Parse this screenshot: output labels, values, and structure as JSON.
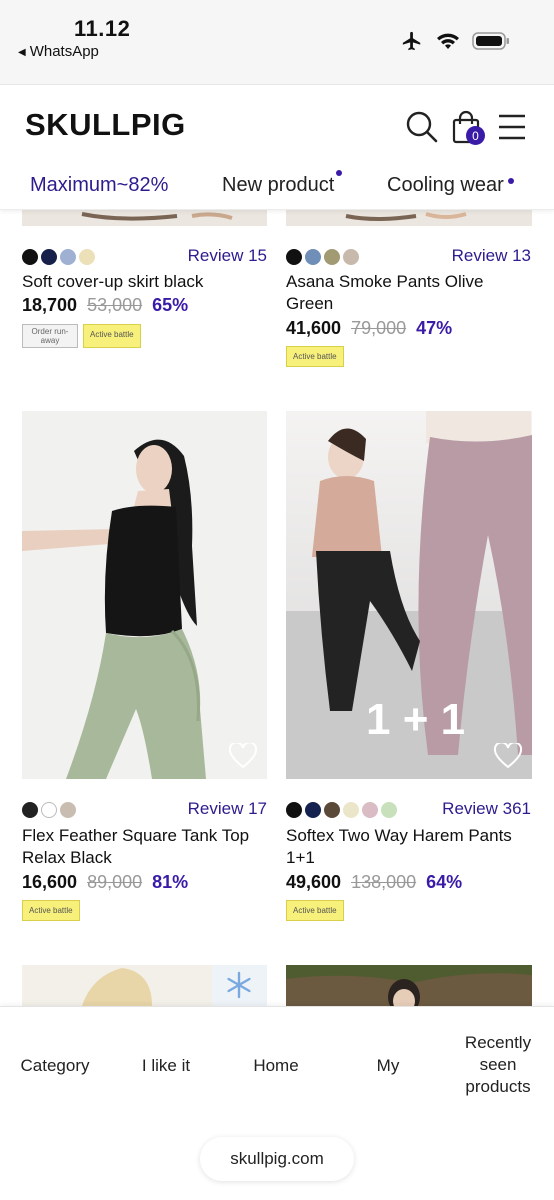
{
  "status_bar": {
    "time": "11.12",
    "back_app": "WhatsApp"
  },
  "header": {
    "logo": "SKULLPIG",
    "cart_count": "0"
  },
  "tabs": [
    {
      "label": "Maximum~82%",
      "active": true
    },
    {
      "label": "New product",
      "active": false
    },
    {
      "label": "Cooling wear",
      "active": false
    }
  ],
  "products": [
    {
      "name": "Soft cover-up skirt black",
      "price": "18,700",
      "old_price": "53,000",
      "discount": "65%",
      "review": "Review 15",
      "swatches": [
        "#111111",
        "#16204a",
        "#9fb0d3",
        "#ece0b8"
      ],
      "tags": [
        {
          "label": "Order run-away",
          "style": "gray"
        },
        {
          "label": "Active battle",
          "style": "yellow"
        }
      ]
    },
    {
      "name": "Asana Smoke Pants Olive Green",
      "price": "41,600",
      "old_price": "79,000",
      "discount": "47%",
      "review": "Review 13",
      "swatches": [
        "#111111",
        "#6f8fb8",
        "#a19a72",
        "#c7b9ab"
      ],
      "tags": [
        {
          "label": "Active battle",
          "style": "yellow"
        }
      ]
    },
    {
      "name": "Flex Feather Square Tank Top Relax Black",
      "price": "16,600",
      "old_price": "89,000",
      "discount": "81%",
      "review": "Review 17",
      "swatches": [
        "#222222",
        "#ffffff",
        "#c9bcb0"
      ],
      "tags": [
        {
          "label": "Active battle",
          "style": "yellow"
        }
      ]
    },
    {
      "name": "Softex Two Way Harem Pants 1+1",
      "price": "49,600",
      "old_price": "138,000",
      "discount": "64%",
      "review": "Review 361",
      "swatches": [
        "#111111",
        "#15224f",
        "#5b4a3a",
        "#ebe6c9",
        "#d9bcc4",
        "#c8e0bb"
      ],
      "tags": [
        {
          "label": "Active battle",
          "style": "yellow"
        }
      ],
      "image_overlay": "1 + 1"
    }
  ],
  "bottom_nav": {
    "items": [
      "Category",
      "I like it",
      "Home",
      "My",
      "Recently seen products"
    ],
    "url": "skullpig.com"
  },
  "colors": {
    "accent": "#3a1ba8",
    "tag_yellow": "#f7f07b"
  }
}
